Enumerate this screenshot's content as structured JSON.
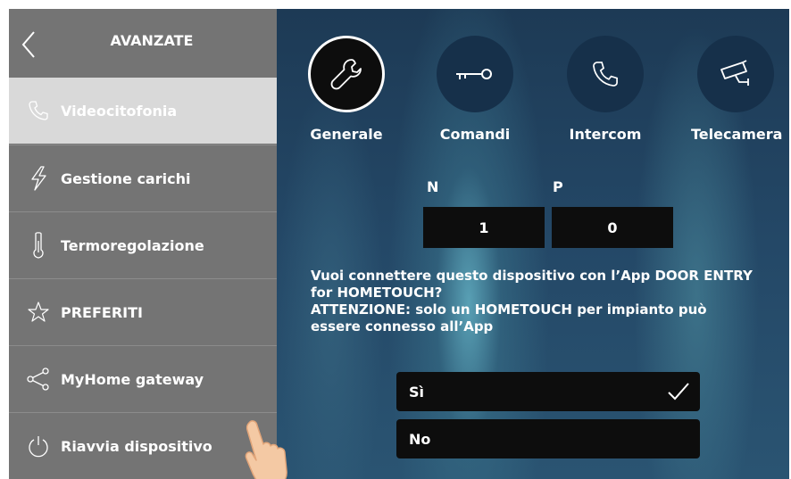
{
  "sidebar": {
    "title": "AVANZATE",
    "back_icon": "chevron-left-icon",
    "items": [
      {
        "label": "Videocitofonia",
        "icon": "phone-icon",
        "active": true
      },
      {
        "label": "Gestione carichi",
        "icon": "lightning-icon",
        "active": false
      },
      {
        "label": "Termoregolazione",
        "icon": "thermometer-icon",
        "active": false
      },
      {
        "label": "PREFERITI",
        "icon": "star-icon",
        "active": false
      },
      {
        "label": "MyHome gateway",
        "icon": "share-icon",
        "active": false
      },
      {
        "label": "Riavvia dispositivo",
        "icon": "power-icon",
        "active": false
      }
    ]
  },
  "tabs": [
    {
      "label": "Generale",
      "icon": "wrench-icon",
      "active": true
    },
    {
      "label": "Comandi",
      "icon": "key-icon",
      "active": false
    },
    {
      "label": "Intercom",
      "icon": "phone-icon",
      "active": false
    },
    {
      "label": "Telecamera",
      "icon": "camera-icon",
      "active": false
    }
  ],
  "np": {
    "n_label": "N",
    "p_label": "P",
    "n_value": "1",
    "p_value": "0"
  },
  "question": {
    "line1": "Vuoi connettere questo dispositivo con l’App DOOR ENTRY for HOMETOUCH?",
    "line2": "ATTENZIONE: solo un HOMETOUCH per impianto può essere connesso all’App"
  },
  "options": [
    {
      "label": "Sì",
      "selected": true
    },
    {
      "label": "No",
      "selected": false
    }
  ],
  "colors": {
    "sidebar_bg": "#747474",
    "sidebar_active_bg": "#d9d9d9",
    "field_bg": "#0d0d0d",
    "text": "#ffffff"
  }
}
